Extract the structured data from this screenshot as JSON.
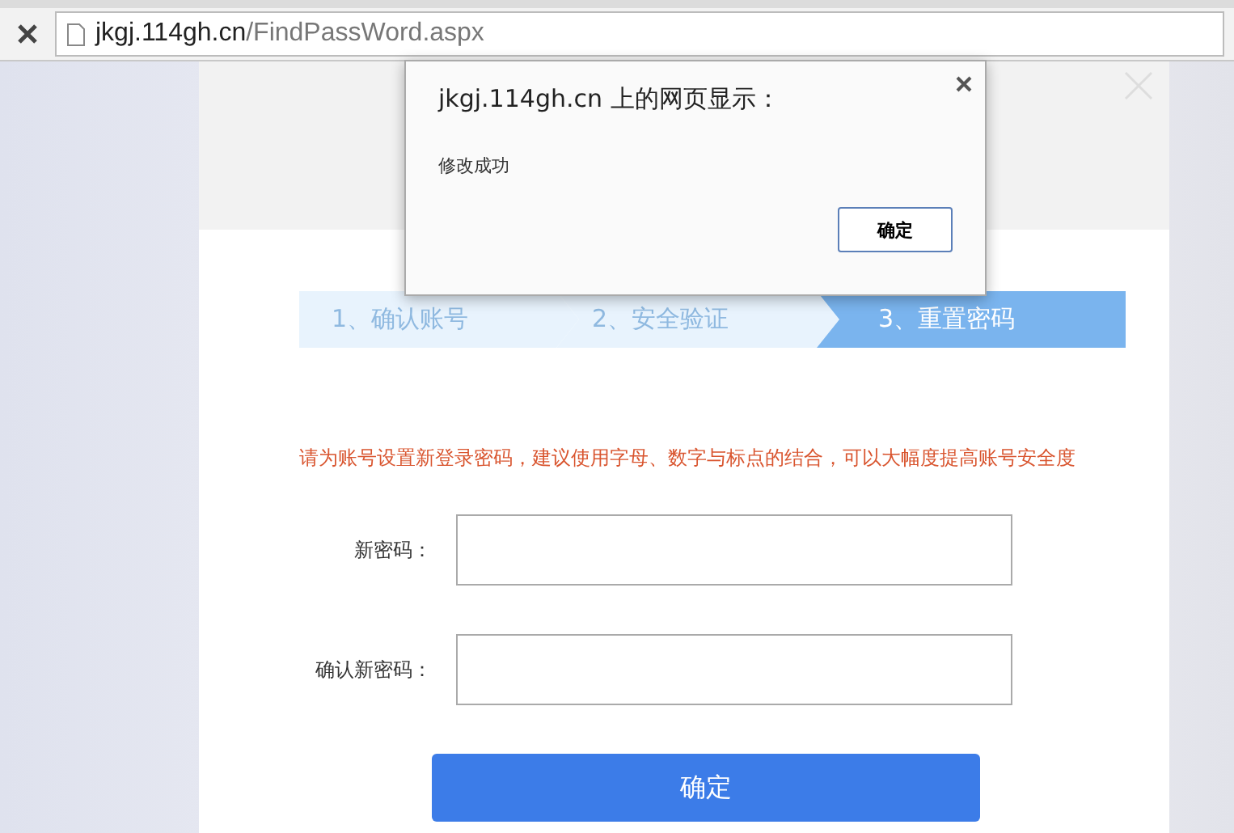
{
  "browser": {
    "address_host": "jkgj.114gh.cn",
    "address_path": "/FindPassWord.aspx"
  },
  "steps": [
    {
      "label": "1、确认账号",
      "selected": false
    },
    {
      "label": "2、安全验证",
      "selected": false
    },
    {
      "label": "3、重置密码",
      "selected": true
    }
  ],
  "hint": "请为账号设置新登录密码，建议使用字母、数字与标点的结合，可以大幅度提高账号安全度",
  "fields": [
    {
      "label": "新密码："
    },
    {
      "label": "确认新密码："
    }
  ],
  "submit_button": "确定",
  "dialog": {
    "title": "jkgj.114gh.cn 上的网页显示：",
    "message": "修改成功",
    "ok_button": "确定"
  }
}
